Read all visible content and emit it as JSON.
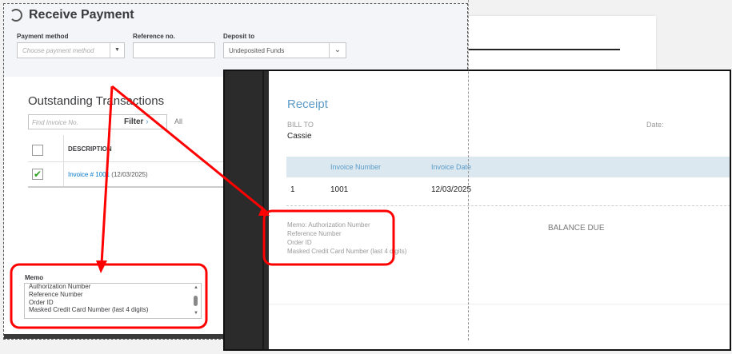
{
  "receive_payment": {
    "title": "Receive Payment",
    "icon": "payment-clock-icon",
    "payment_method": {
      "label": "Payment method",
      "placeholder": "Choose payment method",
      "value": ""
    },
    "reference_no": {
      "label": "Reference no.",
      "value": ""
    },
    "deposit_to": {
      "label": "Deposit to",
      "value": "Undeposited Funds"
    },
    "outstanding": {
      "heading": "Outstanding Transactions",
      "find_placeholder": "Find Invoice No.",
      "filter_label": "Filter",
      "all_label": "All",
      "columns": [
        "DESCRIPTION"
      ],
      "rows": [
        {
          "checked": true,
          "invoice_link": "Invoice # 1001",
          "date": "(12/03/2025)"
        }
      ]
    },
    "memo": {
      "label": "Memo",
      "lines": [
        "Authorization Number",
        "Reference Number",
        "Order ID",
        "Masked Credit Card Number (last 4 digits)"
      ]
    }
  },
  "receipt": {
    "title": "Receipt",
    "bill_to_label": "BILL TO",
    "bill_to_name": "Cassie",
    "date_label": "Date:",
    "columns": [
      "Invoice Number",
      "Invoice Date"
    ],
    "rows": [
      {
        "num": "1",
        "invoice_number": "1001",
        "invoice_date": "12/03/2025"
      }
    ],
    "memo_lines": [
      "Memo: Authorization Number",
      "Reference Number",
      "Order ID",
      "Masked Credit Card Number (last 4 digits)"
    ],
    "balance_due_label": "BALANCE DUE"
  },
  "colors": {
    "annotation": "#ff0000",
    "accent": "#5b9bc7",
    "check": "#2ca01c"
  }
}
